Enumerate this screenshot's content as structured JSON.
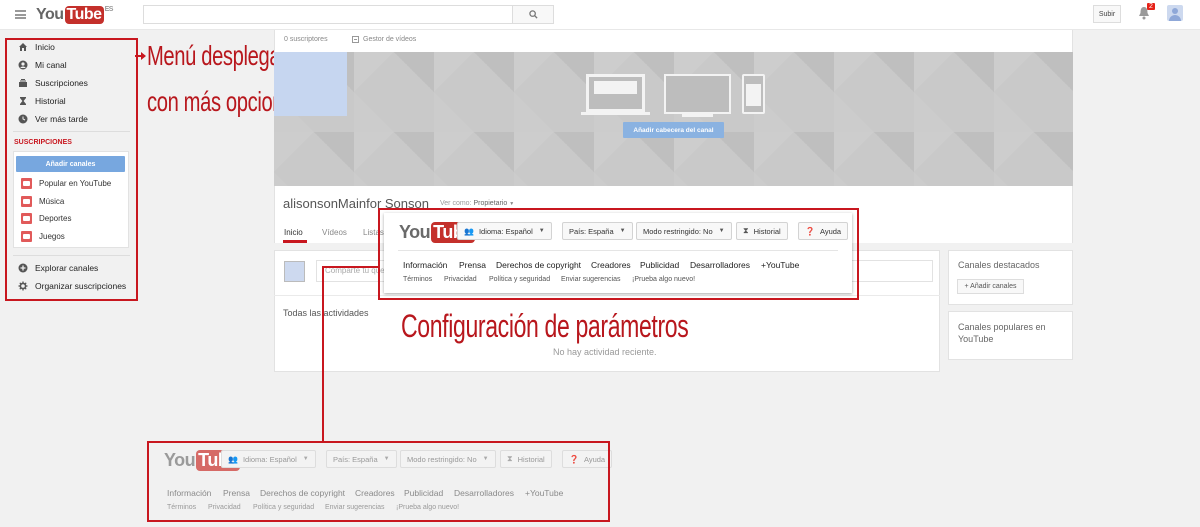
{
  "masthead": {
    "logo_you": "You",
    "logo_tube": "Tube",
    "logo_region": "ES",
    "search_icon": "search-icon",
    "upload_label": "Subir",
    "notifications_count": "2"
  },
  "guide": {
    "items": [
      {
        "label": "Inicio",
        "icon": "home-icon"
      },
      {
        "label": "Mi canal",
        "icon": "user-icon"
      },
      {
        "label": "Suscripciones",
        "icon": "subscriptions-icon"
      },
      {
        "label": "Historial",
        "icon": "hourglass-icon"
      },
      {
        "label": "Ver más tarde",
        "icon": "clock-icon"
      }
    ],
    "subscriptions_title": "SUSCRIPCIONES",
    "add_channels_label": "Añadir canales",
    "subscriptions": [
      {
        "label": "Popular en YouTube"
      },
      {
        "label": "Música"
      },
      {
        "label": "Deportes"
      },
      {
        "label": "Juegos"
      }
    ],
    "bottom_items": [
      {
        "label": "Explorar canales",
        "icon": "plus-circle-icon"
      },
      {
        "label": "Organizar suscripciones",
        "icon": "gear-icon"
      }
    ]
  },
  "channel": {
    "subscribers": "0 suscriptores",
    "video_manager": "Gestor de vídeos",
    "banner_button": "Añadir cabecera del canal",
    "name": "alisonsonMainfor Sonson",
    "view_as_label": "Ver como:",
    "view_as_value": "Propietario",
    "tabs": [
      "Inicio",
      "Vídeos",
      "Listas"
    ],
    "share_placeholder": "Comparte tu que...",
    "activity_title": "Todas las actividades",
    "no_activity": "No hay actividad reciente.",
    "featured_title": "Canales destacados",
    "add_featured": "+ Añadir canales",
    "popular_title": "Canales populares en YouTube"
  },
  "annotations": {
    "menu_line1": "Menú desplegable",
    "menu_line2": "con más opciones",
    "config": "Configuración de parámetros"
  },
  "footer": {
    "language": "Idioma: Español",
    "country": "País: España",
    "restricted": "Modo restringido: No",
    "history": "Historial",
    "help": "Ayuda",
    "links": [
      "Información",
      "Prensa",
      "Derechos de copyright",
      "Creadores",
      "Publicidad",
      "Desarrolladores",
      "+YouTube"
    ],
    "sublinks": [
      "Términos",
      "Privacidad",
      "Política y seguridad",
      "Enviar sugerencias",
      "¡Prueba algo nuevo!"
    ]
  },
  "colors": {
    "accent_red": "#c8171f",
    "button_blue": "#77a7df"
  }
}
